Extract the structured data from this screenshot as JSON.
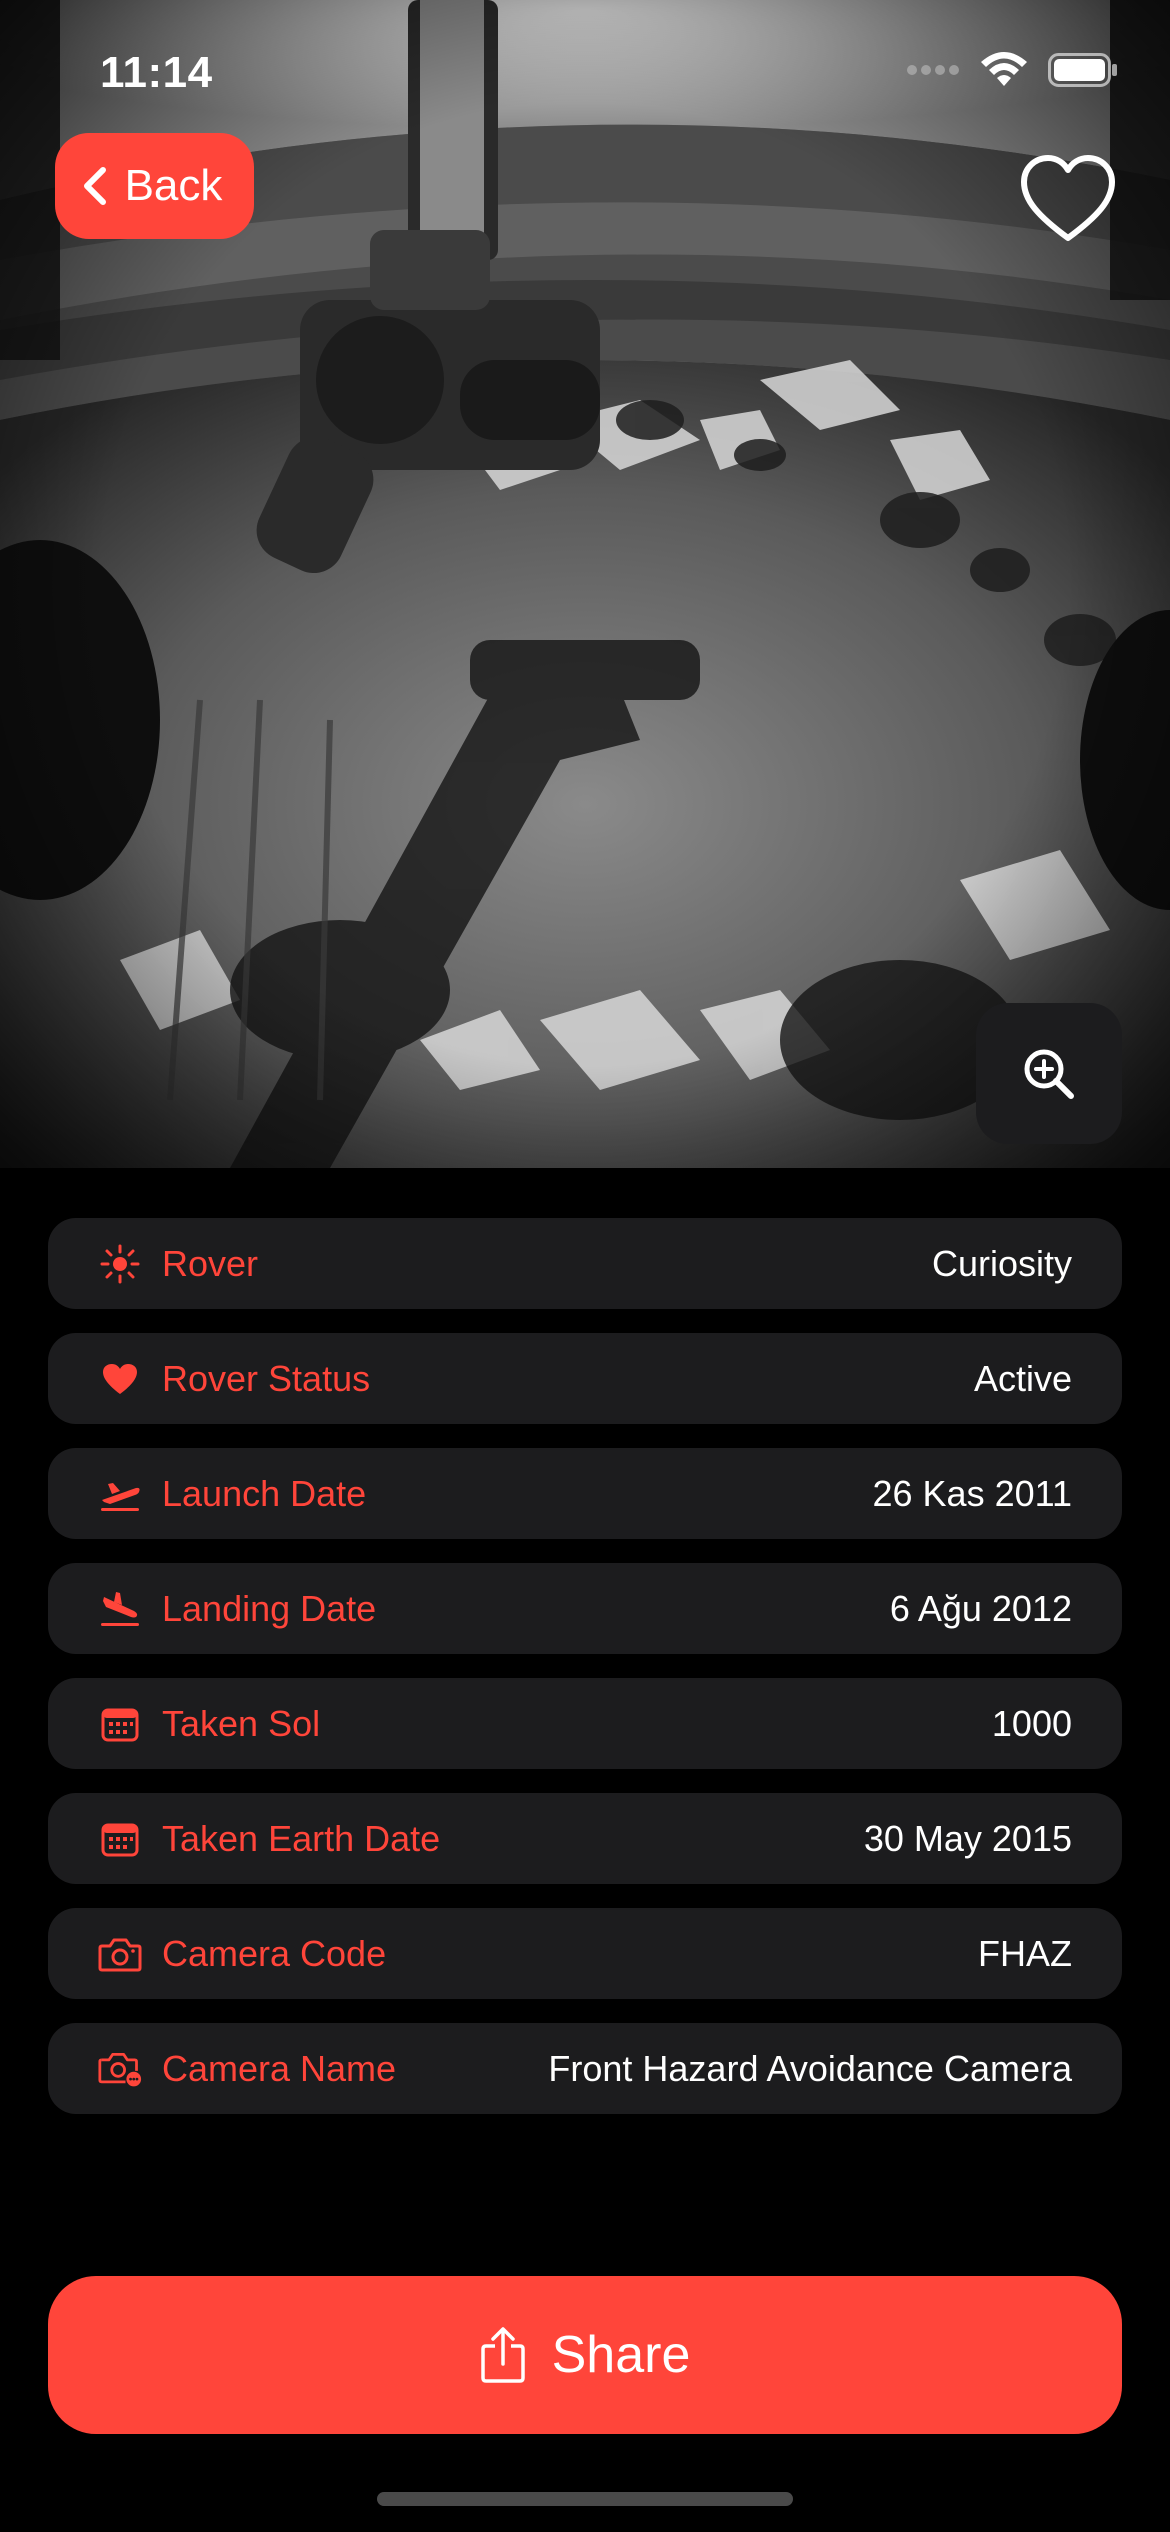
{
  "status_bar": {
    "time": "11:14"
  },
  "photo": {
    "description_icon": "mars-surface-photo"
  },
  "header": {
    "back_label": "Back"
  },
  "details": [
    {
      "icon": "sun-icon",
      "label": "Rover",
      "value": "Curiosity"
    },
    {
      "icon": "heart-icon",
      "label": "Rover Status",
      "value": "Active"
    },
    {
      "icon": "airplane-departure-icon",
      "label": "Launch Date",
      "value": "26 Kas 2011"
    },
    {
      "icon": "airplane-arrival-icon",
      "label": "Landing Date",
      "value": "6 Ağu 2012"
    },
    {
      "icon": "calendar-icon",
      "label": "Taken Sol",
      "value": "1000"
    },
    {
      "icon": "calendar-icon",
      "label": "Taken Earth Date",
      "value": "30 May 2015"
    },
    {
      "icon": "camera-icon",
      "label": "Camera Code",
      "value": "FHAZ"
    },
    {
      "icon": "camera-badge-icon",
      "label": "Camera Name",
      "value": "Front Hazard Avoidance Camera"
    }
  ],
  "actions": {
    "share_label": "Share"
  },
  "colors": {
    "accent": "#ff453a",
    "card": "#1c1c1e",
    "background": "#000000"
  }
}
